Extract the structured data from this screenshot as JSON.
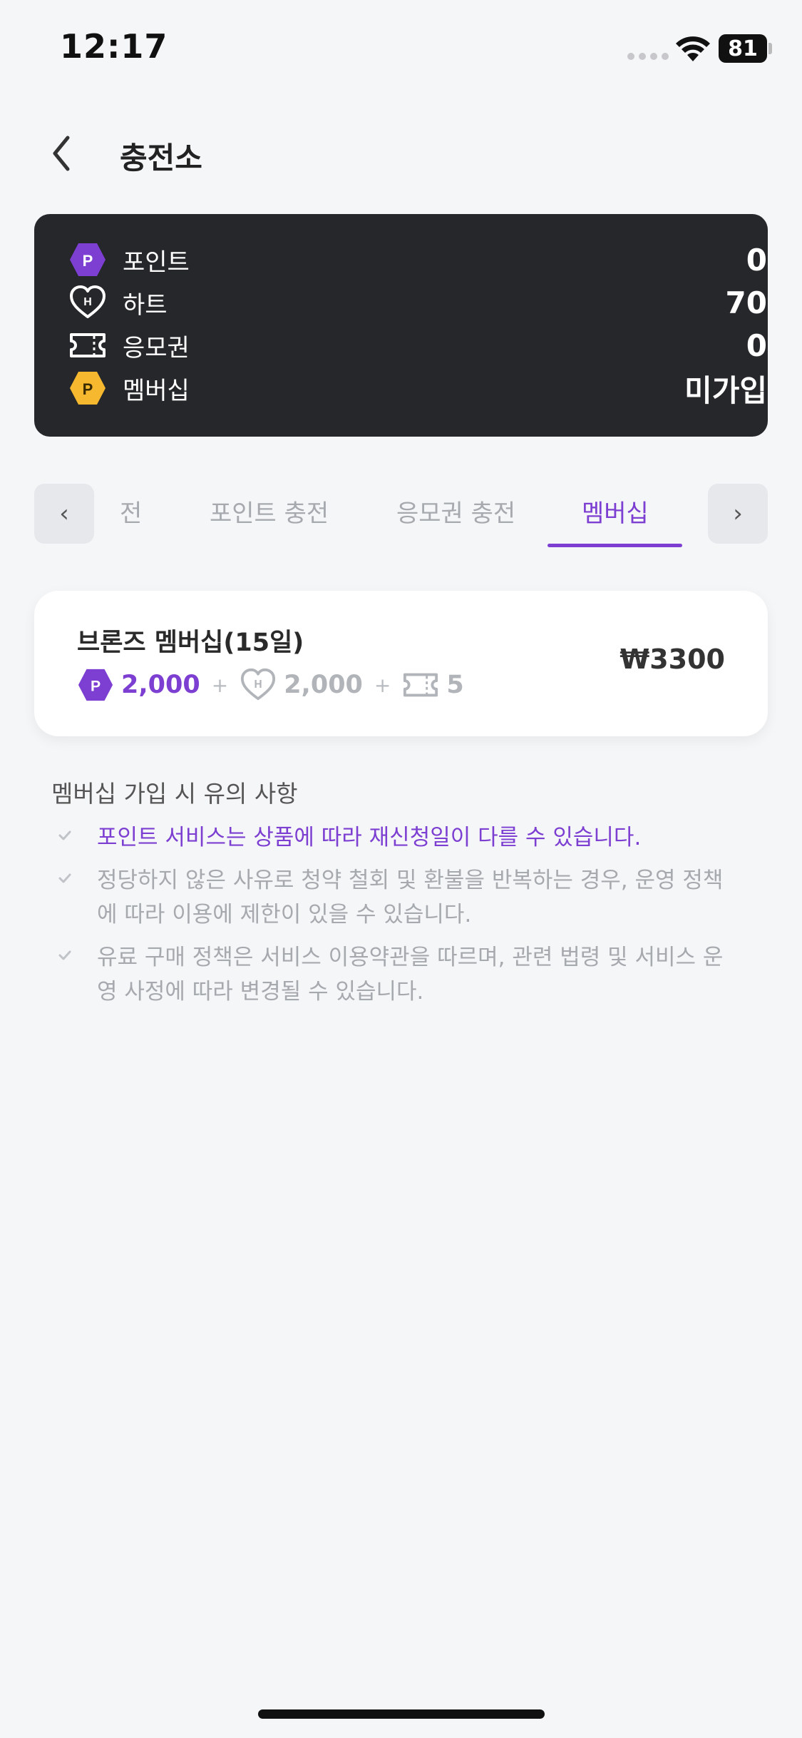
{
  "status_bar": {
    "time": "12:17",
    "battery": "81"
  },
  "header": {
    "title": "충전소"
  },
  "balances": [
    {
      "label": "포인트",
      "value": "0",
      "icon": "points-hex-icon"
    },
    {
      "label": "하트",
      "value": "70",
      "icon": "heart-icon"
    },
    {
      "label": "응모권",
      "value": "0",
      "icon": "ticket-icon"
    },
    {
      "label": "멤버십",
      "value": "미가입",
      "icon": "membership-hex-icon"
    }
  ],
  "icon_letters": {
    "points": "P",
    "heart": "H",
    "membership": "P"
  },
  "tabs": {
    "prev": "‹",
    "next": "›",
    "items": [
      "전",
      "포인트 충전",
      "응모권 충전",
      "멤버십"
    ],
    "active_index": 3
  },
  "product": {
    "title": "브론즈 멤버십(15일)",
    "points": "2,000",
    "hearts": "2,000",
    "tickets": "5",
    "plus": "+",
    "price": "₩3300"
  },
  "notice": {
    "title": "멤버십 가입 시 유의 사항",
    "items": [
      "포인트 서비스는 상품에 따라 재신청일이 다를 수 있습니다.",
      "정당하지 않은 사유로 청약 철회 및 환불을 반복하는 경우, 운영 정책에 따라 이용에 제한이 있을 수 있습니다.",
      "유료 구매 정책은 서비스 이용약관을 따르며, 관련 법령 및 서비스 운영 사정에 따라 변경될 수 있습니다."
    ]
  },
  "colors": {
    "accent": "#7c3fd1",
    "membership": "#f5b82e",
    "card_dark": "#25272b",
    "background": "#f5f6f8"
  }
}
